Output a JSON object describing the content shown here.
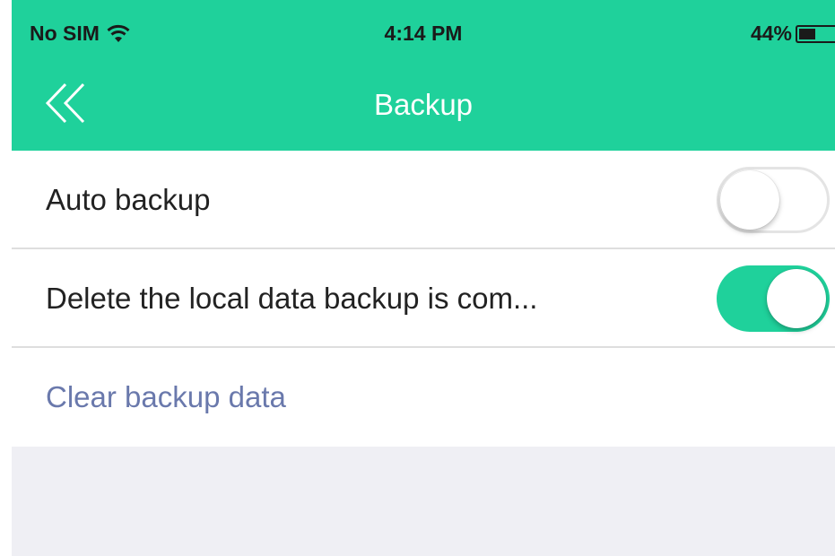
{
  "status_bar": {
    "carrier": "No SIM",
    "wifi_icon": "wifi-icon",
    "time": "4:14 PM",
    "battery_percent": "44%",
    "battery_level": 0.44
  },
  "nav": {
    "back_icon": "double-chevron-left-icon",
    "title": "Backup"
  },
  "settings": {
    "auto_backup": {
      "label": "Auto backup",
      "enabled": false
    },
    "delete_local": {
      "label": "Delete the local data backup is com...",
      "enabled": true
    },
    "clear_backup": {
      "label": "Clear backup data"
    }
  },
  "colors": {
    "accent": "#1fd19b",
    "link": "#6a79ac",
    "background": "#efeff4"
  }
}
